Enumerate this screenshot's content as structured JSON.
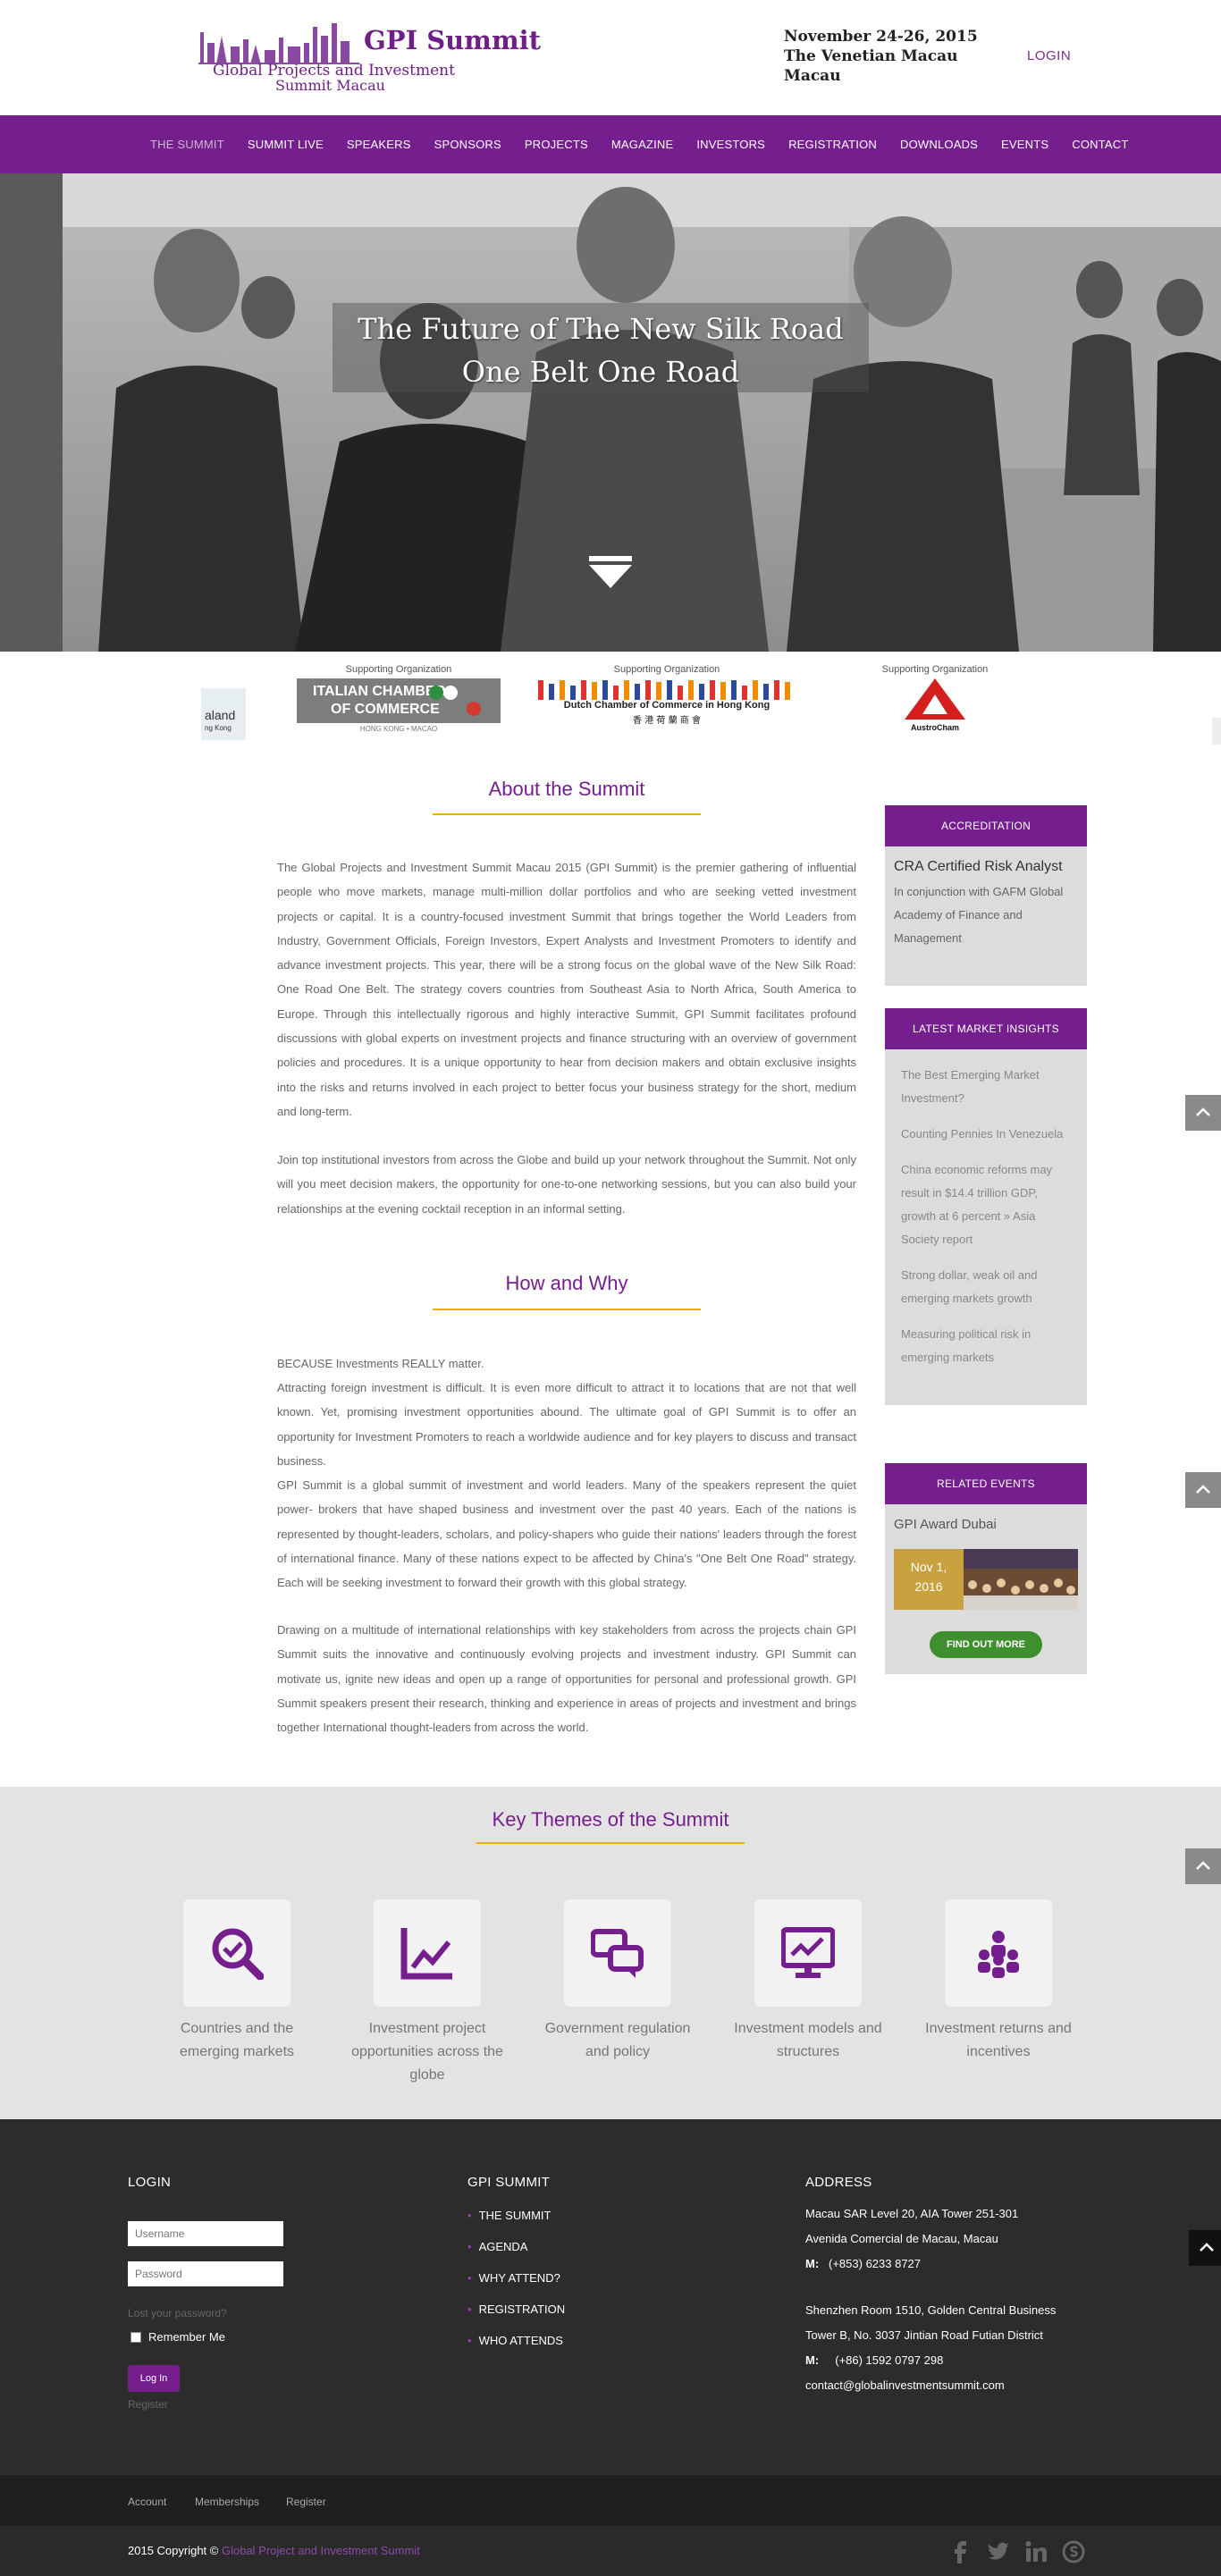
{
  "header": {
    "logo_title": "GPI Summit",
    "logo_sub1": "Global Projects and Investment",
    "logo_sub2": "Summit Macau",
    "event_date": "November 24-26, 2015",
    "event_venue": "The Venetian Macau",
    "event_city": "Macau",
    "login": "LOGIN"
  },
  "nav": {
    "items": [
      "THE SUMMIT",
      "SUMMIT LIVE",
      "SPEAKERS",
      "SPONSORS",
      "PROJECTS",
      "MAGAZINE",
      "INVESTORS",
      "REGISTRATION",
      "DOWNLOADS",
      "EVENTS",
      "CONTACT"
    ]
  },
  "hero": {
    "line1": "The Future of The New Silk Road",
    "line2": "One Belt One Road"
  },
  "sponsors": {
    "label": "Supporting Organization",
    "partial_text1": "aland",
    "partial_text2": "ng Kong",
    "italian_line1": "ITALIAN CHAMBER",
    "italian_line2": "OF COMMERCE",
    "italian_sub": "HONG KONG • MACAO",
    "dutch_text": "Dutch Chamber of Commerce in Hong Kong",
    "dutch_chinese": "香 港 荷 蘭 商 會",
    "austro_text": "AustroCham"
  },
  "about": {
    "title": "About the Summit",
    "p1": "The Global Projects and Investment Summit Macau 2015 (GPI Summit) is the premier gathering of influential people who move markets, manage multi-million dollar portfolios and who are seeking vetted investment projects or capital. It is a country-focused investment Summit that brings together the World Leaders from Industry, Government Officials, Foreign Investors, Expert Analysts and Investment Promoters to identify and advance investment projects. This year, there will be a strong focus on the global wave of the New Silk Road: One Road One Belt. The strategy covers countries from Southeast Asia to North Africa, South America to Europe. Through this intellectually rigorous and highly interactive Summit, GPI Summit facilitates profound discussions with global experts on investment projects and finance structuring with an overview of government policies and procedures. It is a unique opportunity to hear from decision makers and obtain exclusive insights into the risks and returns involved in each project to better focus your business strategy for the short, medium and long-term.",
    "p2": "Join top institutional investors from across the Globe and build up your network throughout the Summit. Not only will you meet decision makers, the opportunity for one-to-one networking sessions, but you can also build your relationships at the evening cocktail reception in an informal setting."
  },
  "how": {
    "title": "How and Why",
    "p1": "BECAUSE Investments REALLY matter.",
    "p2": "Attracting foreign investment is difficult. It is even more difficult to attract it to locations that are not that well known. Yet, promising investment opportunities abound. The ultimate goal of GPI Summit is to offer an opportunity for Investment Promoters to reach a worldwide audience and for key players to discuss and transact business.",
    "p3": "GPI Summit is a global summit of investment and world leaders. Many of the speakers represent the quiet power- brokers that have shaped business and investment over the past 40 years. Each of the nations is represented by thought-leaders, scholars, and policy-shapers who guide their nations' leaders through the forest of international finance. Many of these nations expect to be affected by China's \"One Belt One Road\" strategy. Each will be seeking investment to forward their growth with this global strategy.",
    "p4": "Drawing on a multitude of international relationships with key stakeholders from across the projects chain GPI Summit suits the innovative and continuously evolving projects and investment industry. GPI Summit can motivate us, ignite new ideas and open up a range of opportunities for personal and professional growth. GPI Summit speakers present their research, thinking and experience in areas of projects and investment and brings together International thought-leaders from across the world."
  },
  "sidebar": {
    "accreditation_head": "ACCREDITATION",
    "accreditation_title": "CRA Certified Risk Analyst",
    "accreditation_text": "In conjunction with GAFM Global Academy of Finance and Management",
    "insights_head": "LATEST MARKET INSIGHTS",
    "insights": [
      "The Best Emerging Market Investment?",
      "Counting Pennies In Venezuela",
      "China economic reforms may result in $14.4 trillion GDP, growth at 6 percent » Asia Society report",
      "Strong dollar, weak oil and emerging markets growth",
      "Measuring political risk in emerging markets"
    ],
    "events_head": "RELATED EVENTS",
    "event_title": "GPI Award Dubai",
    "event_date_line1": "Nov 1,",
    "event_date_line2": "2016",
    "find_more": "FIND OUT MORE"
  },
  "themes": {
    "title": "Key Themes of the Summit",
    "items": [
      {
        "label": "Countries and the emerging markets",
        "icon": "search-check-icon"
      },
      {
        "label": "Investment project opportunities across the globe",
        "icon": "line-chart-icon"
      },
      {
        "label": "Government regulation and policy",
        "icon": "chat-bubbles-icon"
      },
      {
        "label": "Investment models and structures",
        "icon": "monitor-chart-icon"
      },
      {
        "label": "Investment returns and incentives",
        "icon": "people-group-icon"
      }
    ]
  },
  "footer": {
    "login_head": "LOGIN",
    "username_placeholder": "Username",
    "password_placeholder": "Password",
    "lost_password": "Lost your password?",
    "remember": "Remember Me",
    "login_button": "Log In",
    "register": "Register",
    "summit_head": "GPI SUMMIT",
    "summit_links": [
      "THE SUMMIT",
      "AGENDA",
      "WHY ATTEND?",
      "REGISTRATION",
      "WHO ATTENDS"
    ],
    "address_head": "ADDRESS",
    "macau_line1": "Macau SAR Level 20, AIA Tower 251-301",
    "macau_line2": "Avenida Comercial de Macau, Macau",
    "macau_phone_label": "M:",
    "macau_phone": "(+853) 6233 8727",
    "sz_line1": "Shenzhen Room 1510, Golden Central Business",
    "sz_line2": "Tower B, No. 3037 Jintian Road Futian District",
    "sz_phone_label": "M:",
    "sz_phone": "(+86) 1592 0797 298",
    "email": "contact@globalinvestmentsummit.com"
  },
  "bottom": {
    "links": [
      "Account",
      "Memberships",
      "Register"
    ],
    "copyright_prefix": "2015 Copyright ©",
    "copyright_name": "Global Project and Investment Summit"
  },
  "colors": {
    "brand_purple": "#751f8e",
    "accent_gold": "#e8b000",
    "button_green": "#3f8f2f"
  }
}
